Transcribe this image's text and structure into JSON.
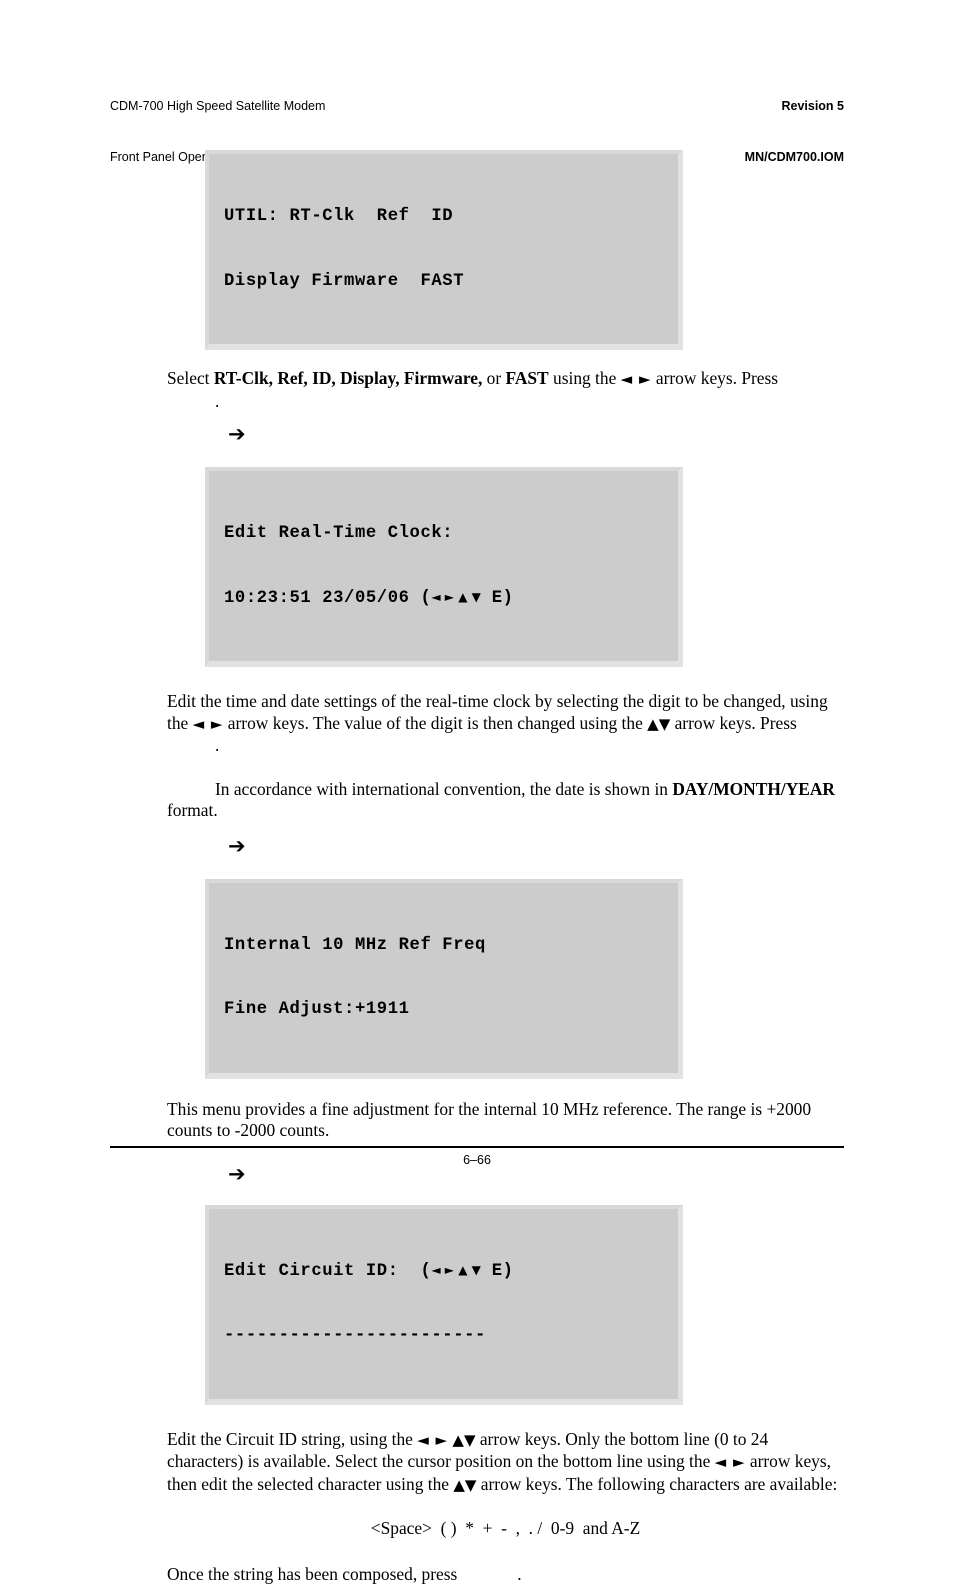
{
  "header": {
    "left_line1": "CDM-700 High Speed Satellite Modem",
    "left_line2": "Front Panel Operation",
    "right_line1": "Revision 5",
    "right_line2": "MN/CDM700.IOM"
  },
  "lcd_screens": [
    {
      "name": "util-menu",
      "line1": "UTIL: RT-Clk  Ref  ID",
      "line2": "Display Firmware  FAST"
    },
    {
      "name": "edit-real-time-clock",
      "line1": "Edit Real-Time Clock:",
      "line2_prefix": "10:23:51 23/05/06 (",
      "line2_arrows": "◄ ► ▲ ▼",
      "line2_suffix": " E)"
    },
    {
      "name": "internal-ref-freq",
      "line1": "Internal 10 MHz Ref Freq",
      "line2": "Fine Adjust:+1911"
    },
    {
      "name": "edit-circuit-id",
      "line1_prefix": "Edit Circuit ID:  (",
      "line1_arrows": "◄ ► ▲ ▼",
      "line1_suffix": " E)",
      "line2": "------------------------"
    }
  ],
  "paragraphs": {
    "util_select": {
      "t1": "Select ",
      "b1": "RT-Clk, Ref, ID, Display, Firmware,",
      "t2": " or ",
      "b2": "FAST",
      "t3": " using the ",
      "arrows": "◄ ►",
      "t4": " arrow keys. Press",
      "trailing_dot": "."
    },
    "clock_edit": {
      "t1": "Edit the time and date settings of  the real-time clock by selecting the digit to be changed, using the ",
      "arrows1": "◄ ►",
      "t2": " arrow keys. The value of the digit is then changed using the ",
      "arrows2": "▲▼",
      "t3": " arrow keys. Press",
      "trailing_dot": "."
    },
    "date_convention": {
      "t1": "In accordance with international convention, the date is shown in ",
      "b1": "DAY/MONTH/YEAR",
      "t2": " format."
    },
    "fine_adjust": {
      "t1": "This menu provides a fine adjustment for the internal 10 MHz reference. The range is +2000 counts to -2000 counts."
    },
    "circuit_id_edit": {
      "t1": "Edit the Circuit ID string, using the ",
      "arrows1": "◄ ►",
      "t2": "  ",
      "arrows2": "▲▼",
      "t3": " arrow keys. Only the bottom line (0 to 24 characters) is available. Select the cursor position on the bottom line using the ",
      "arrows3": "◄ ►",
      "t4": " arrow keys, then edit the selected character using the ",
      "arrows4": "▲▼",
      "t5": " arrow keys. The following characters are available:"
    },
    "charset": "<Space>  ( )  *  +  -  ,  . /  0-9  and A-Z",
    "compose_done": {
      "t1": "Once the string has been composed, press",
      "trailing_dot": "."
    }
  },
  "markers": {
    "arrow_bullet": "➔"
  },
  "footer": {
    "page_number": "6–66"
  },
  "colors": {
    "lcd_background": "#cccccc",
    "lcd_border_light": "#d9d9d9",
    "page_background": "#ffffff",
    "text": "#000000"
  }
}
